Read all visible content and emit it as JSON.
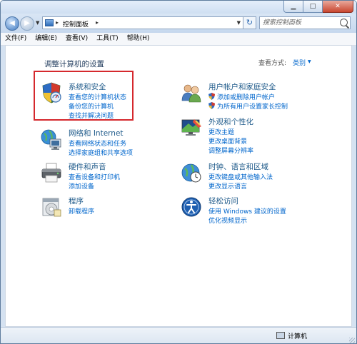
{
  "address": {
    "path_label": "控制面板",
    "search_placeholder": "搜索控制面板"
  },
  "menu": [
    "文件(F)",
    "编辑(E)",
    "查看(V)",
    "工具(T)",
    "帮助(H)"
  ],
  "content": {
    "heading": "调整计算机的设置",
    "view_by_label": "查看方式:",
    "view_by_value": "类别"
  },
  "categories": [
    {
      "title": "系统和安全",
      "links": [
        "查看您的计算机状态",
        "备份您的计算机",
        "查找并解决问题"
      ],
      "icon": "shield-icon"
    },
    {
      "title": "网络和 Internet",
      "links": [
        "查看网络状态和任务",
        "选择家庭组和共享选项"
      ],
      "icon": "network-icon"
    },
    {
      "title": "硬件和声音",
      "links": [
        "查看设备和打印机",
        "添加设备"
      ],
      "icon": "printer-icon"
    },
    {
      "title": "程序",
      "links": [
        "卸载程序"
      ],
      "icon": "programs-icon"
    },
    {
      "title": "用户帐户和家庭安全",
      "links": [
        "添加或删除用户帐户",
        "为所有用户设置家长控制"
      ],
      "icon": "users-icon"
    },
    {
      "title": "外观和个性化",
      "links": [
        "更改主题",
        "更改桌面背景",
        "调整屏幕分辨率"
      ],
      "icon": "appearance-icon"
    },
    {
      "title": "时钟、语言和区域",
      "links": [
        "更改键盘或其他输入法",
        "更改显示语言"
      ],
      "icon": "clock-globe-icon"
    },
    {
      "title": "轻松访问",
      "links": [
        "使用 Windows 建议的设置",
        "优化视频显示"
      ],
      "icon": "ease-of-access-icon"
    }
  ],
  "status": {
    "text": "计算机"
  }
}
